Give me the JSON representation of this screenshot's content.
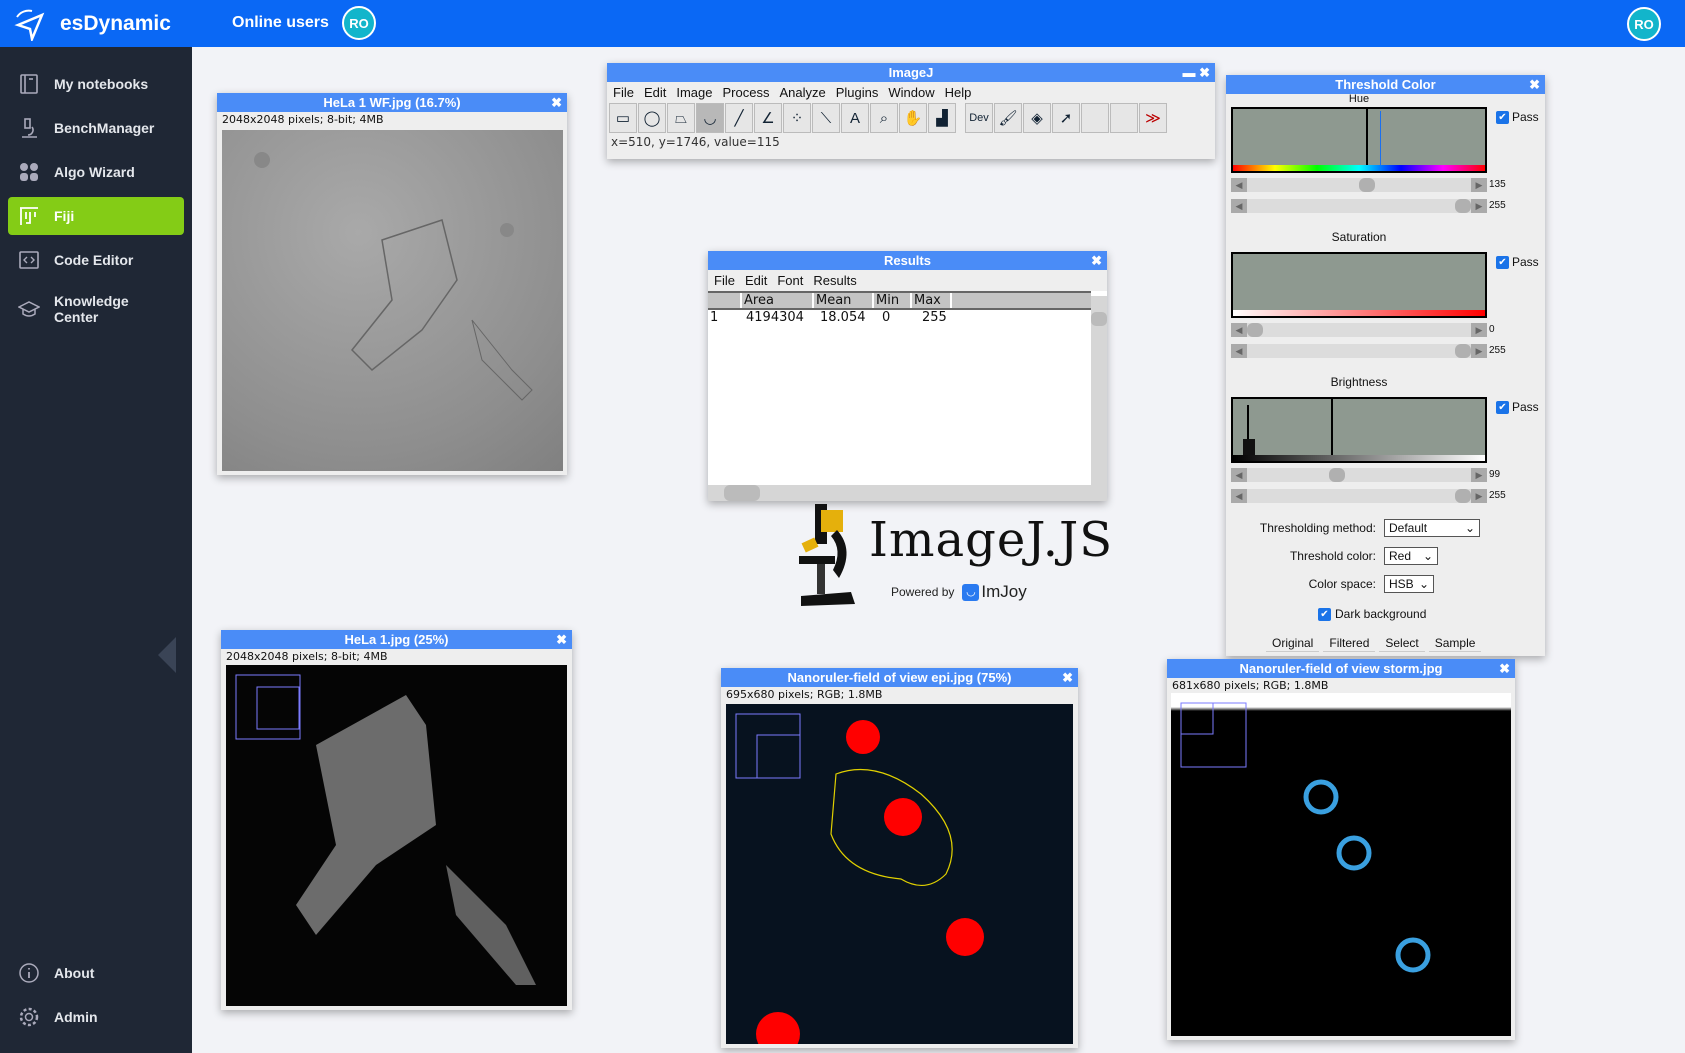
{
  "app": {
    "brand": "esDynamic",
    "online_label": "Online users",
    "user_initials": "RO",
    "accent": "#0a68f5",
    "active_color": "#84cc16"
  },
  "sidebar": {
    "items": [
      {
        "label": "My notebooks",
        "icon": "notebook-icon"
      },
      {
        "label": "BenchManager",
        "icon": "microscope-icon"
      },
      {
        "label": "Algo Wizard",
        "icon": "grid-icon"
      },
      {
        "label": "Fiji",
        "icon": "fiji-icon",
        "active": true
      },
      {
        "label": "Code Editor",
        "icon": "code-icon"
      },
      {
        "label": "Knowledge Center",
        "icon": "graduation-cap-icon"
      }
    ],
    "bottom": [
      {
        "label": "About",
        "icon": "info-icon"
      },
      {
        "label": "Admin",
        "icon": "gear-icon"
      }
    ]
  },
  "imagej": {
    "title": "ImageJ",
    "menu": [
      "File",
      "Edit",
      "Image",
      "Process",
      "Analyze",
      "Plugins",
      "Window",
      "Help"
    ],
    "tools": [
      "▭",
      "◯",
      "⏢",
      "◡",
      "╱",
      "∠",
      "⁘",
      "⟍",
      "A",
      "⌕",
      "✋",
      "▟",
      "Dev",
      "🖌",
      "◈",
      "➚",
      "",
      "",
      "≫"
    ],
    "status": "x=510, y=1746, value=115"
  },
  "results": {
    "title": "Results",
    "menu": [
      "File",
      "Edit",
      "Font",
      "Results"
    ],
    "columns": [
      "",
      "Area",
      "Mean",
      "Min",
      "Max"
    ],
    "rows": [
      [
        "1",
        "4194304",
        "18.054",
        "0",
        "255"
      ]
    ]
  },
  "logo": {
    "text": "ImageJ.JS",
    "powered": "Powered by",
    "imjoy": "ImJoy"
  },
  "threshold": {
    "title": "Threshold Color",
    "hue_label": "Hue",
    "sat_label": "Saturation",
    "bri_label": "Brightness",
    "pass": "Pass",
    "hue_min": "135",
    "hue_max": "255",
    "sat_min": "0",
    "sat_max": "255",
    "bri_min": "99",
    "bri_max": "255",
    "method_label": "Thresholding method:",
    "method": "Default",
    "color_label": "Threshold color:",
    "color": "Red",
    "space_label": "Color space:",
    "space": "HSB",
    "dark_bg": "Dark background",
    "buttons": [
      "Original",
      "Filtered",
      "Select",
      "Sample"
    ]
  },
  "windows": [
    {
      "title": "HeLa 1 WF.jpg (16.7%)",
      "info": "2048x2048 pixels; 8-bit; 4MB"
    },
    {
      "title": "HeLa 1.jpg (25%)",
      "info": "2048x2048 pixels; 8-bit; 4MB"
    },
    {
      "title": "Nanoruler-field of view epi.jpg (75%)",
      "info": "695x680 pixels; RGB; 1.8MB"
    },
    {
      "title": "Nanoruler-field of view storm.jpg",
      "info": "681x680 pixels; RGB; 1.8MB"
    }
  ]
}
